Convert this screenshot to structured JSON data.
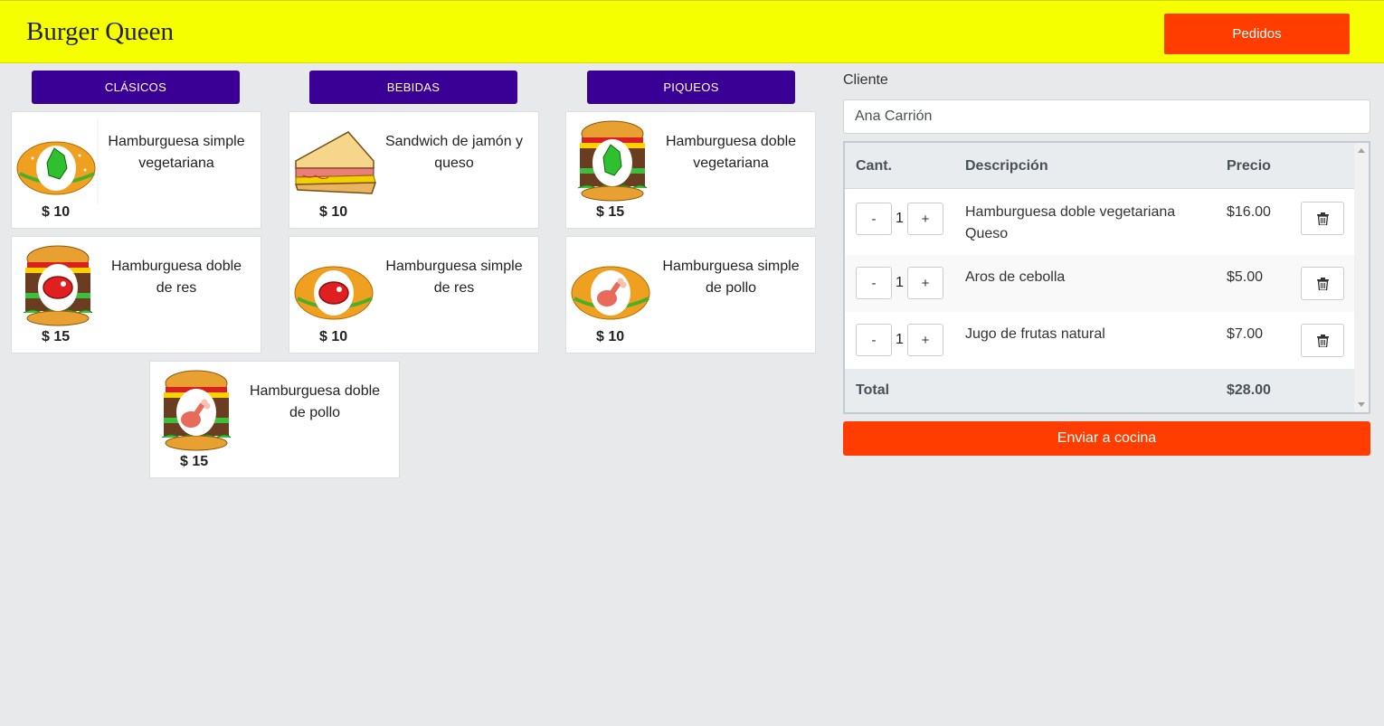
{
  "header": {
    "brand": "Burger Queen",
    "orders_label": "Pedidos"
  },
  "colors": {
    "header_bg": "#f5ff00",
    "accent": "#ff3d00",
    "category": "#3a0096"
  },
  "categories": [
    "CLÁSICOS",
    "BEBIDAS",
    "PIQUEOS"
  ],
  "menu": [
    {
      "name": "Hamburguesa simple vegetariana",
      "price": "$ 10",
      "icon": "single-veggie-burger-icon"
    },
    {
      "name": "Sandwich de jamón y queso",
      "price": "$ 10",
      "icon": "ham-cheese-sandwich-icon"
    },
    {
      "name": "Hamburguesa doble vegetariana",
      "price": "$ 15",
      "icon": "double-veggie-burger-icon"
    },
    {
      "name": "Hamburguesa doble de res",
      "price": "$ 15",
      "icon": "double-beef-burger-icon"
    },
    {
      "name": "Hamburguesa simple de res",
      "price": "$ 10",
      "icon": "single-beef-burger-icon"
    },
    {
      "name": "Hamburguesa simple de pollo",
      "price": "$ 10",
      "icon": "single-chicken-burger-icon"
    },
    {
      "name": "Hamburguesa doble de pollo",
      "price": "$ 15",
      "icon": "double-chicken-burger-icon"
    }
  ],
  "order": {
    "client_label": "Cliente",
    "client_value": "Ana Carrión",
    "columns": {
      "qty": "Cant.",
      "desc": "Descripción",
      "price": "Precio"
    },
    "minus": "-",
    "plus": "+",
    "items": [
      {
        "qty": "1",
        "desc": "Hamburguesa doble vegetariana Queso",
        "price": "$16.00"
      },
      {
        "qty": "1",
        "desc": "Aros de cebolla",
        "price": "$5.00"
      },
      {
        "qty": "1",
        "desc": "Jugo de frutas natural",
        "price": "$7.00"
      }
    ],
    "total_label": "Total",
    "total_value": "$28.00",
    "send_label": "Enviar a cocina"
  }
}
